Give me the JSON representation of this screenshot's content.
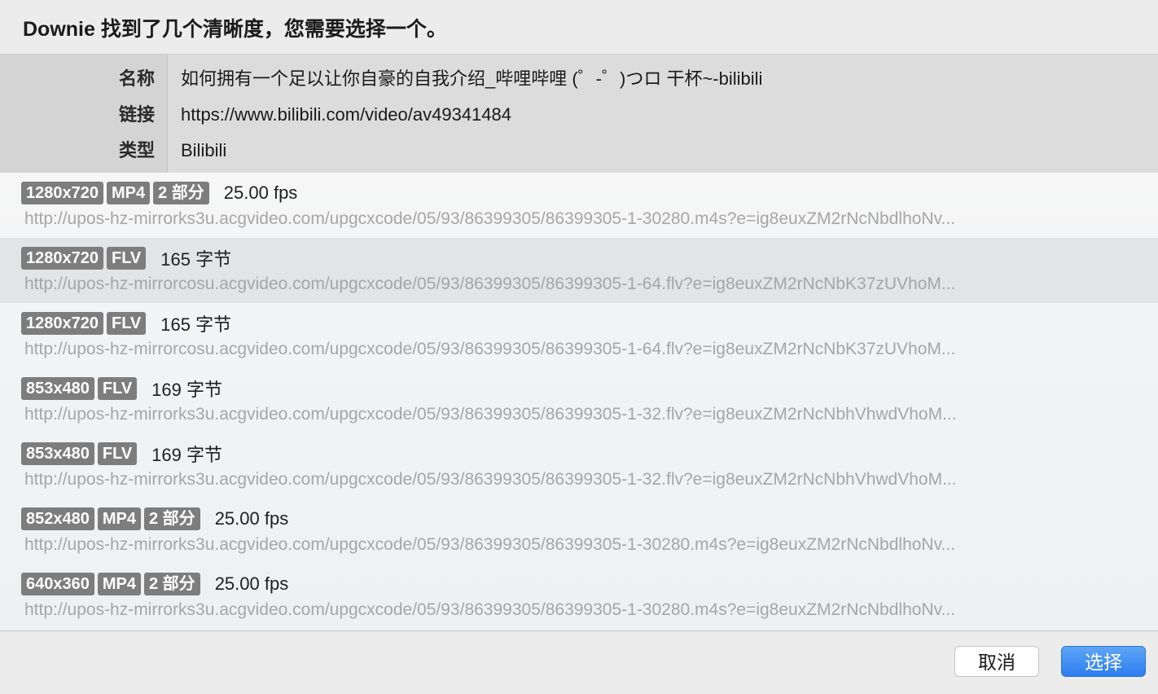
{
  "title": "Downie 找到了几个清晰度，您需要选择一个。",
  "info": {
    "name_label": "名称",
    "name_value": "如何拥有一个足以让你自豪的自我介绍_哔哩哔哩 (゜-゜)つロ 干杯~-bilibili",
    "link_label": "链接",
    "link_value": "https://www.bilibili.com/video/av49341484",
    "type_label": "类型",
    "type_value": "Bilibili"
  },
  "options": [
    {
      "resolution": "1280x720",
      "format": "MP4",
      "parts": "2 部分",
      "meta": "25.00 fps",
      "url": "http://upos-hz-mirrorks3u.acgvideo.com/upgcxcode/05/93/86399305/86399305-1-30280.m4s?e=ig8euxZM2rNcNbdlhoNv...",
      "selected": false
    },
    {
      "resolution": "1280x720",
      "format": "FLV",
      "parts": "",
      "meta": "165 字节",
      "url": "http://upos-hz-mirrorcosu.acgvideo.com/upgcxcode/05/93/86399305/86399305-1-64.flv?e=ig8euxZM2rNcNbK37zUVhoM...",
      "selected": true
    },
    {
      "resolution": "1280x720",
      "format": "FLV",
      "parts": "",
      "meta": "165 字节",
      "url": "http://upos-hz-mirrorcosu.acgvideo.com/upgcxcode/05/93/86399305/86399305-1-64.flv?e=ig8euxZM2rNcNbK37zUVhoM...",
      "selected": false
    },
    {
      "resolution": "853x480",
      "format": "FLV",
      "parts": "",
      "meta": "169 字节",
      "url": "http://upos-hz-mirrorks3u.acgvideo.com/upgcxcode/05/93/86399305/86399305-1-32.flv?e=ig8euxZM2rNcNbhVhwdVhoM...",
      "selected": false
    },
    {
      "resolution": "853x480",
      "format": "FLV",
      "parts": "",
      "meta": "169 字节",
      "url": "http://upos-hz-mirrorks3u.acgvideo.com/upgcxcode/05/93/86399305/86399305-1-32.flv?e=ig8euxZM2rNcNbhVhwdVhoM...",
      "selected": false
    },
    {
      "resolution": "852x480",
      "format": "MP4",
      "parts": "2 部分",
      "meta": "25.00 fps",
      "url": "http://upos-hz-mirrorks3u.acgvideo.com/upgcxcode/05/93/86399305/86399305-1-30280.m4s?e=ig8euxZM2rNcNbdlhoNv...",
      "selected": false
    },
    {
      "resolution": "640x360",
      "format": "MP4",
      "parts": "2 部分",
      "meta": "25.00 fps",
      "url": "http://upos-hz-mirrorks3u.acgvideo.com/upgcxcode/05/93/86399305/86399305-1-30280.m4s?e=ig8euxZM2rNcNbdlhoNv...",
      "selected": false
    }
  ],
  "buttons": {
    "cancel": "取消",
    "select": "选择"
  },
  "colors": {
    "badge": "#7d7d7d",
    "accent": "#2c7df0",
    "selected_row": "#e2e4e5",
    "url_text": "#a6a6a6"
  }
}
